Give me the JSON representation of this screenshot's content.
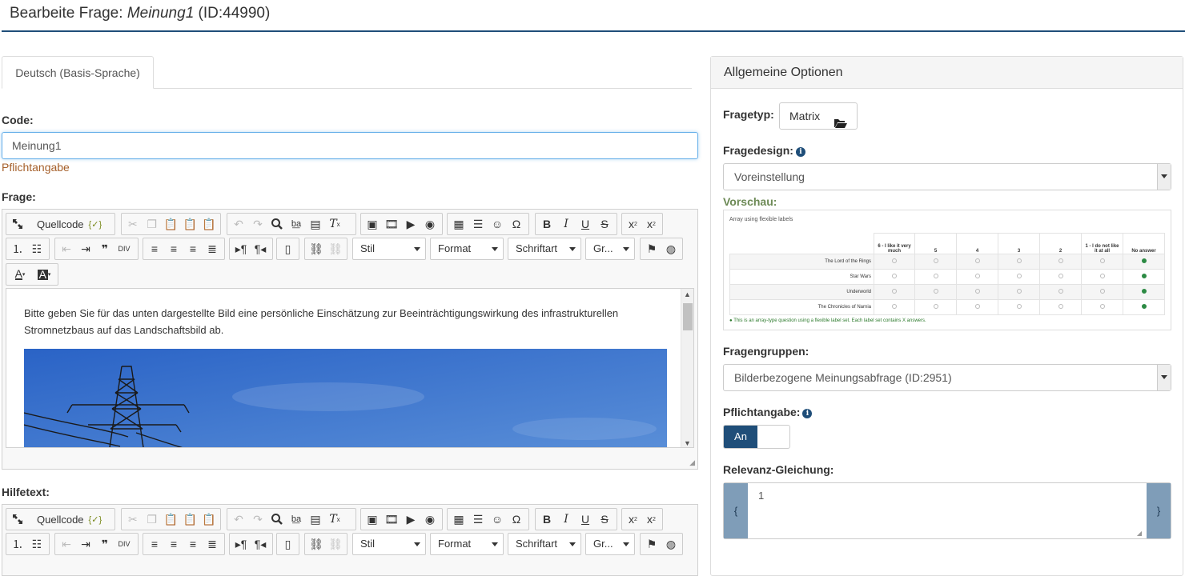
{
  "header": {
    "title_prefix": "Bearbeite Frage:",
    "question_name": "Meinung1",
    "question_id": "(ID:44990)"
  },
  "tabs": [
    {
      "label": "Deutsch (Basis-Sprache)"
    }
  ],
  "form": {
    "code_label": "Code:",
    "code_value": "Meinung1",
    "required_note": "Pflichtangabe",
    "question_label": "Frage:",
    "help_label": "Hilfetext:",
    "question_text": "Bitte geben Sie für das unten dargestellte Bild eine persönliche Einschätzung zur Beeinträchtigungswirkung des infrastrukturellen Stromnetzbaus auf das Landschaftsbild ab."
  },
  "editor_toolbar": {
    "source_label": "Quellcode",
    "style_combo": "Stil",
    "format_combo": "Format",
    "font_combo": "Schriftart",
    "size_combo": "Gr..."
  },
  "options_panel": {
    "title": "Allgemeine Optionen",
    "type_label": "Fragetyp:",
    "type_value": "Matrix",
    "design_label": "Fragedesign:",
    "design_value": "Voreinstellung",
    "preview_label": "Vorschau:",
    "preview": {
      "caption": "Array using flexible labels",
      "columns": [
        "6 - I like it very much",
        "5",
        "4",
        "3",
        "2",
        "1 - I do not like it at all",
        "No answer"
      ],
      "rows": [
        "The Lord of the Rings",
        "Star Wars",
        "Underworld",
        "The Chronicles of Narnia"
      ],
      "footer": "This is an array-type question using a flexible label set. Each label set contains X answers."
    },
    "group_label": "Fragengruppen:",
    "group_value": "Bilderbezogene Meinungsabfrage (ID:2951)",
    "mandatory_label": "Pflichtangabe:",
    "mandatory_on": "An",
    "relevance_label": "Relevanz-Gleichung:",
    "relevance_open": "{",
    "relevance_value": "1",
    "relevance_close": "}"
  },
  "colors": {
    "brand": "#1f4e79",
    "required": "#a55f2a",
    "preview_label": "#6d8a56",
    "focus": "#66afe9"
  }
}
